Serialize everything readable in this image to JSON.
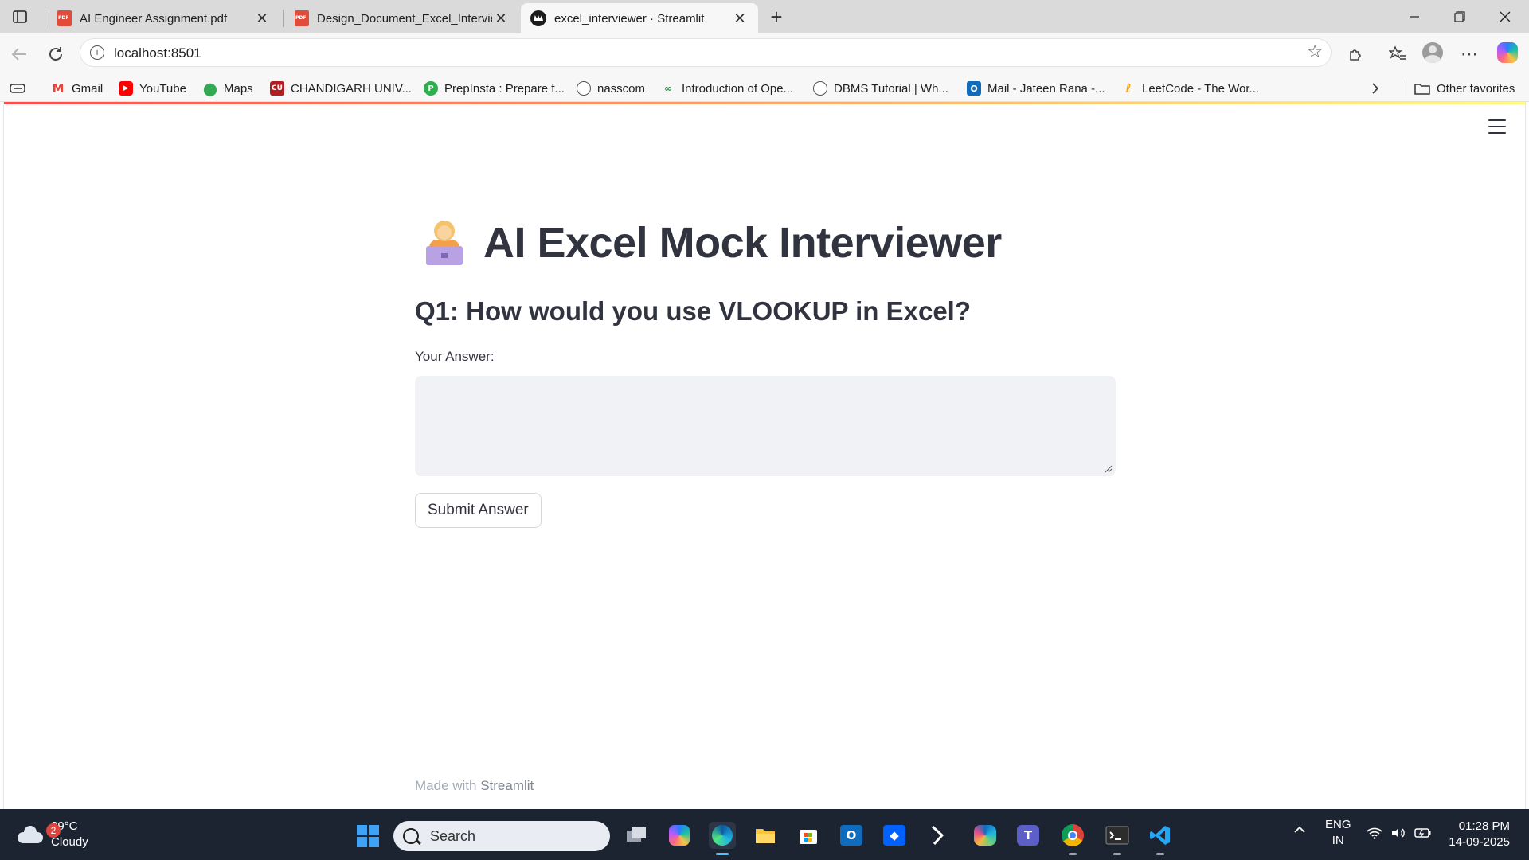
{
  "browser": {
    "tabs": [
      {
        "title": "AI Engineer Assignment.pdf",
        "icon": "pdf-icon",
        "active": false
      },
      {
        "title": "Design_Document_Excel_Interview",
        "icon": "pdf-icon",
        "active": false
      },
      {
        "title": "excel_interviewer · Streamlit",
        "icon": "streamlit-icon",
        "active": true
      }
    ],
    "close_glyph": "✕",
    "new_tab_glyph": "+",
    "address": "localhost:8501",
    "bookmarks": [
      {
        "label": "Gmail",
        "icon": "gmail-icon"
      },
      {
        "label": "YouTube",
        "icon": "youtube-icon"
      },
      {
        "label": "Maps",
        "icon": "maps-icon"
      },
      {
        "label": "CHANDIGARH UNIV...",
        "icon": "cu-icon"
      },
      {
        "label": "PrepInsta : Prepare f...",
        "icon": "prepinsta-icon"
      },
      {
        "label": "nasscom",
        "icon": "globe-icon"
      },
      {
        "label": "Introduction of Ope...",
        "icon": "gfg-icon"
      },
      {
        "label": "DBMS Tutorial | Wh...",
        "icon": "globe-icon"
      },
      {
        "label": "Mail - Jateen Rana -...",
        "icon": "outlook-icon"
      },
      {
        "label": "LeetCode - The Wor...",
        "icon": "leetcode-icon"
      }
    ],
    "other_favorites": "Other favorites"
  },
  "app": {
    "title": "AI Excel Mock Interviewer",
    "question": "Q1: How would you use VLOOKUP in Excel?",
    "answer_label": "Your Answer:",
    "answer_value": "",
    "submit_label": "Submit Answer",
    "footer_prefix": "Made with ",
    "footer_brand": "Streamlit",
    "accent_gradient": [
      "#ff4b4b",
      "#fffd80"
    ]
  },
  "taskbar": {
    "weather_badge": "2",
    "temperature": "29°C",
    "condition": "Cloudy",
    "search_placeholder": "Search",
    "language": "ENG",
    "region": "IN",
    "time": "01:28 PM",
    "date": "14-09-2025",
    "apps": [
      "task-view",
      "copilot",
      "edge",
      "file-explorer",
      "store",
      "outlook",
      "dropbox",
      "cursor",
      "m365",
      "teams",
      "chrome",
      "terminal",
      "vscode"
    ]
  }
}
